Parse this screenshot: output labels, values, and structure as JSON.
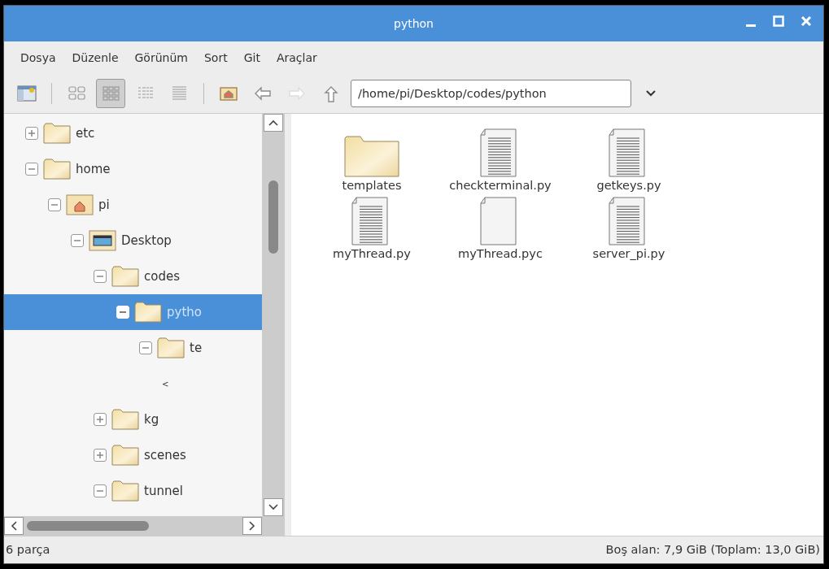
{
  "window": {
    "title": "python"
  },
  "menu": [
    "Dosya",
    "Düzenle",
    "Görünüm",
    "Sort",
    "Git",
    "Araçlar"
  ],
  "toolbar": {
    "view_modes": [
      {
        "kind": "icons",
        "selected": false
      },
      {
        "kind": "thumbnails",
        "selected": true
      },
      {
        "kind": "compact",
        "selected": false
      },
      {
        "kind": "list",
        "selected": false
      }
    ],
    "nav": [
      {
        "kind": "home",
        "disabled": false
      },
      {
        "kind": "back",
        "disabled": false
      },
      {
        "kind": "forward",
        "disabled": true
      },
      {
        "kind": "up",
        "disabled": false
      }
    ],
    "path": "/home/pi/Desktop/codes/python"
  },
  "tree": [
    {
      "label": "etc",
      "kind": "folder",
      "expanded": false,
      "selected": false
    },
    {
      "label": "home",
      "kind": "folder",
      "expanded": true,
      "selected": false,
      "children": [
        {
          "label": "pi",
          "kind": "home",
          "expanded": true,
          "selected": false,
          "children": [
            {
              "label": "Desktop",
              "kind": "desktop",
              "expanded": true,
              "selected": false,
              "children": [
                {
                  "label": "codes",
                  "kind": "folder",
                  "expanded": true,
                  "selected": false,
                  "children": [
                    {
                      "label": "pytho",
                      "kind": "folder",
                      "expanded": true,
                      "selected": true,
                      "children": [
                        {
                          "label": "te",
                          "kind": "folder",
                          "expanded": true,
                          "selected": false,
                          "children": [
                            {
                              "label": "<",
                              "kind": "fragment"
                            }
                          ]
                        }
                      ]
                    }
                  ]
                },
                {
                  "label": "kg",
                  "kind": "folder",
                  "expanded": false,
                  "selected": false
                },
                {
                  "label": "scenes",
                  "kind": "folder",
                  "expanded": false,
                  "selected": false
                },
                {
                  "label": "tunnel",
                  "kind": "folder",
                  "expanded": true,
                  "selected": false
                }
              ]
            }
          ]
        }
      ]
    }
  ],
  "files": [
    {
      "name": "templates",
      "kind": "folder"
    },
    {
      "name": "checkterminal.py",
      "kind": "text"
    },
    {
      "name": "getkeys.py",
      "kind": "text"
    },
    {
      "name": "myThread.py",
      "kind": "text"
    },
    {
      "name": "myThread.pyc",
      "kind": "binary"
    },
    {
      "name": "server_pi.py",
      "kind": "text"
    }
  ],
  "status_bar": {
    "count": "6 parça",
    "free_space": "Boş alan: 7,9 GiB (Toplam: 13,0 GiB)"
  }
}
